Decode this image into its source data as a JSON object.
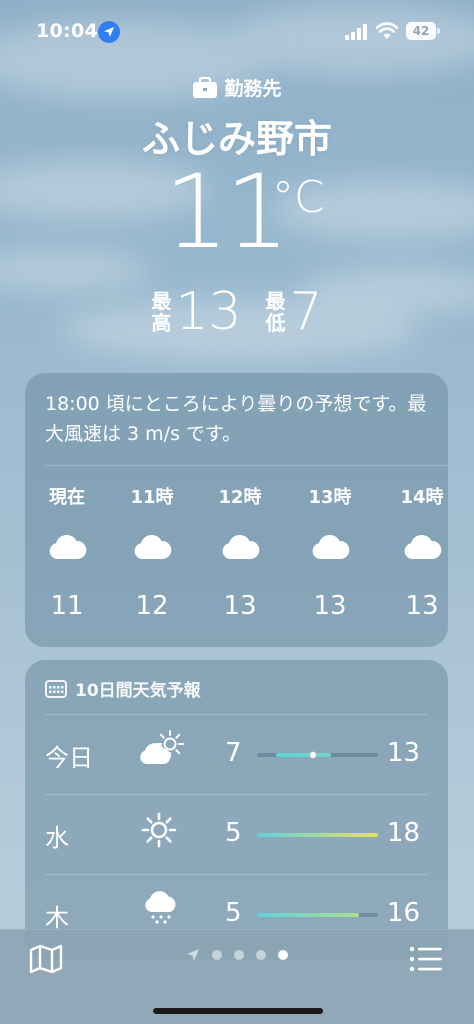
{
  "status": {
    "time": "10:04",
    "battery": "42"
  },
  "location": {
    "label": "勤務先",
    "city": "ふじみ野市",
    "temperature": "11",
    "unit": "°C",
    "high_label_1": "最",
    "high_label_2": "高",
    "high": "13",
    "low_label_1": "最",
    "low_label_2": "低",
    "low": "7"
  },
  "hourly": {
    "summary": "18:00 頃にところにより曇りの予想です。最大風速は 3 m/s です。",
    "items": [
      {
        "label": "現在",
        "icon": "cloud-icon",
        "temp": "11"
      },
      {
        "label": "11時",
        "icon": "cloud-icon",
        "temp": "12"
      },
      {
        "label": "12時",
        "icon": "cloud-icon",
        "temp": "13"
      },
      {
        "label": "13時",
        "icon": "cloud-icon",
        "temp": "13"
      },
      {
        "label": "14時",
        "icon": "cloud-icon",
        "temp": "13"
      }
    ]
  },
  "daily": {
    "title": "10日間天気予報",
    "range_min": 5,
    "range_max": 18,
    "items": [
      {
        "day": "今日",
        "icon": "partly-sunny-icon",
        "low": "7",
        "high": "13",
        "low_val": 7,
        "high_val": 13,
        "current_val": 11,
        "gradient": [
          "#5fd3d6",
          "#6fd6c8"
        ]
      },
      {
        "day": "水",
        "icon": "sun-icon",
        "low": "5",
        "high": "18",
        "low_val": 5,
        "high_val": 18,
        "gradient": [
          "#5fd3e0",
          "#e8e060"
        ]
      },
      {
        "day": "木",
        "icon": "rain-cloud-icon",
        "low": "5",
        "high": "16",
        "low_val": 5,
        "high_val": 16,
        "gradient": [
          "#5fd3e0",
          "#a8e08c"
        ]
      }
    ]
  },
  "toolbar": {
    "pages": 4,
    "active_page": 3
  }
}
